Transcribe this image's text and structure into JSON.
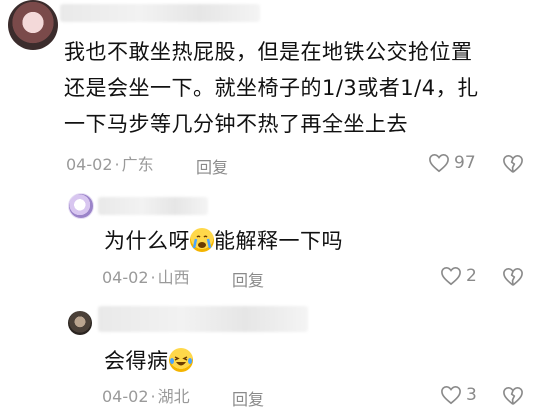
{
  "comments": [
    {
      "text_line1": "我也不敢坐热屁股，但是在地铁公交抢位置",
      "text_line2": "还是会坐一下。就坐椅子的1/3或者1/4，扎",
      "text_line3": "一下马步等几分钟不热了再全坐上去",
      "date": "04-02",
      "location": "广东",
      "reply_label": "回复",
      "likes": "97"
    },
    {
      "text_before": "为什么呀",
      "emoji": "crying-face",
      "text_after": "能解释一下吗",
      "date": "04-02",
      "location": "山西",
      "reply_label": "回复",
      "likes": "2"
    },
    {
      "text_before": "会得病",
      "emoji": "laughing-tears-face",
      "text_after": "",
      "date": "04-02",
      "location": "湖北",
      "reply_label": "回复",
      "likes": "3"
    }
  ],
  "separator": "·",
  "colors": {
    "text": "#111111",
    "meta": "#9a9a9a",
    "icon": "#8a8a8a"
  }
}
